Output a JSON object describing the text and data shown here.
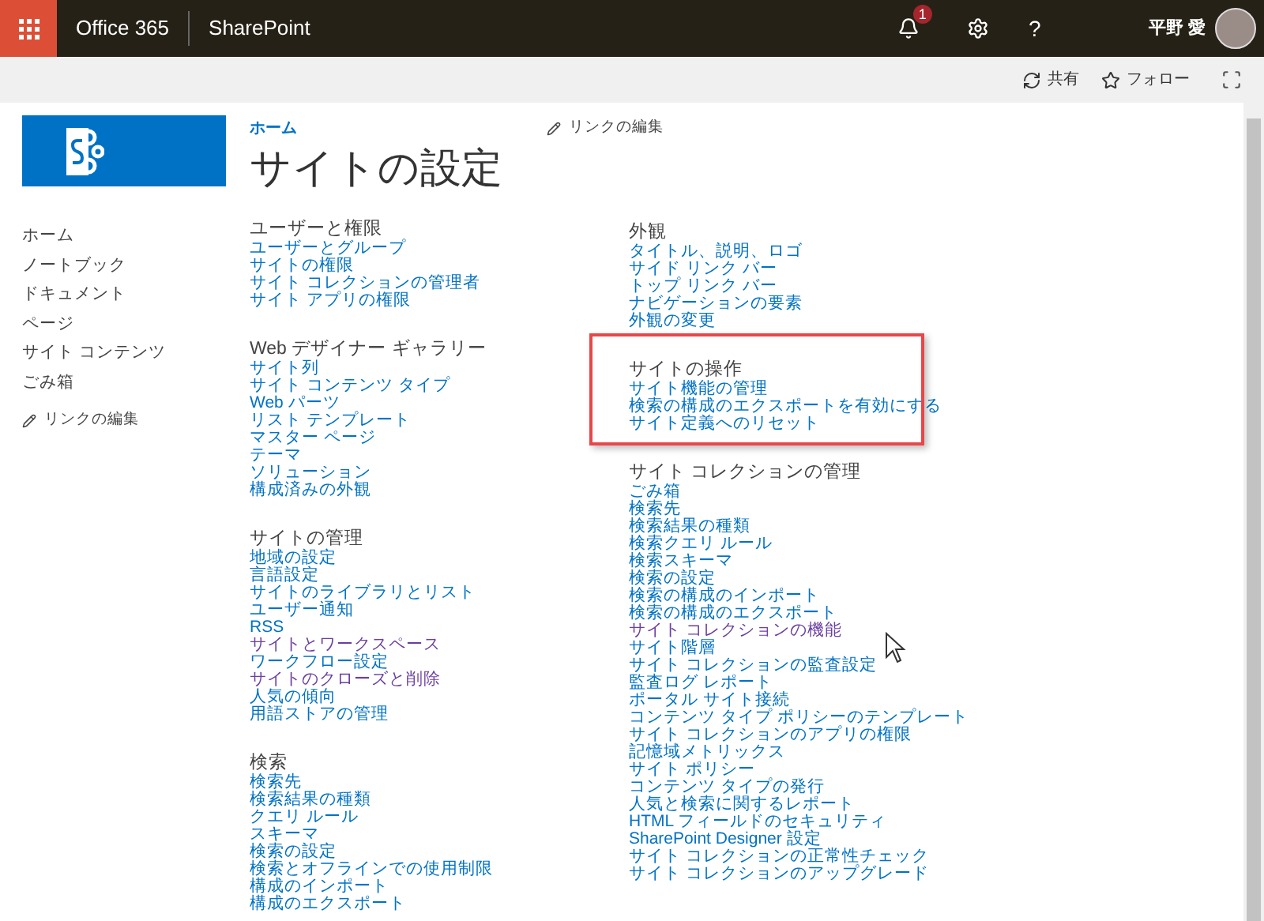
{
  "app_bar": {
    "brand": "Office 365",
    "app": "SharePoint",
    "notification_count": "1",
    "help": "?",
    "user_name": "平野 愛"
  },
  "toolbar": {
    "actions": [
      {
        "label": "共有",
        "kind": "share"
      },
      {
        "label": "フォロー",
        "kind": "follow"
      }
    ]
  },
  "breadcrumb": {
    "home": "ホーム",
    "edit_links": "リンクの編集"
  },
  "title": "サイトの設定",
  "quick_launch": {
    "items": [
      "ホーム",
      "ノートブック",
      "ドキュメント",
      "ページ",
      "サイト コンテンツ",
      "ごみ箱"
    ],
    "edit_links": "リンクの編集"
  },
  "columns": [
    {
      "sections": [
        {
          "heading": "ユーザーと権限",
          "highlighted": false,
          "links": [
            {
              "label": "ユーザーとグループ",
              "visited": false
            },
            {
              "label": "サイトの権限",
              "visited": false
            },
            {
              "label": "サイト コレクションの管理者",
              "visited": false
            },
            {
              "label": "サイト アプリの権限",
              "visited": false
            }
          ]
        },
        {
          "heading": "Web デザイナー ギャラリー",
          "highlighted": false,
          "links": [
            {
              "label": "サイト列",
              "visited": false
            },
            {
              "label": "サイト コンテンツ タイプ",
              "visited": false
            },
            {
              "label": "Web パーツ",
              "visited": false
            },
            {
              "label": "リスト テンプレート",
              "visited": false
            },
            {
              "label": "マスター ページ",
              "visited": false
            },
            {
              "label": "テーマ",
              "visited": false
            },
            {
              "label": "ソリューション",
              "visited": false
            },
            {
              "label": "構成済みの外観",
              "visited": false
            }
          ]
        },
        {
          "heading": "サイトの管理",
          "highlighted": false,
          "links": [
            {
              "label": "地域の設定",
              "visited": false
            },
            {
              "label": "言語設定",
              "visited": false
            },
            {
              "label": "サイトのライブラリとリスト",
              "visited": false
            },
            {
              "label": "ユーザー通知",
              "visited": false
            },
            {
              "label": "RSS",
              "visited": false
            },
            {
              "label": "サイトとワークスペース",
              "visited": true
            },
            {
              "label": "ワークフロー設定",
              "visited": false
            },
            {
              "label": "サイトのクローズと削除",
              "visited": true
            },
            {
              "label": "人気の傾向",
              "visited": false
            },
            {
              "label": "用語ストアの管理",
              "visited": false
            }
          ]
        },
        {
          "heading": "検索",
          "highlighted": false,
          "links": [
            {
              "label": "検索先",
              "visited": false
            },
            {
              "label": "検索結果の種類",
              "visited": false
            },
            {
              "label": "クエリ ルール",
              "visited": false
            },
            {
              "label": "スキーマ",
              "visited": false
            },
            {
              "label": "検索の設定",
              "visited": false
            },
            {
              "label": "検索とオフラインでの使用制限",
              "visited": false
            },
            {
              "label": "構成のインポート",
              "visited": false
            },
            {
              "label": "構成のエクスポート",
              "visited": false
            }
          ]
        }
      ]
    },
    {
      "sections": [
        {
          "heading": "外観",
          "highlighted": false,
          "links": [
            {
              "label": "タイトル、説明、ロゴ",
              "visited": false
            },
            {
              "label": "サイド リンク バー",
              "visited": false
            },
            {
              "label": "トップ リンク バー",
              "visited": false
            },
            {
              "label": "ナビゲーションの要素",
              "visited": false
            },
            {
              "label": "外観の変更",
              "visited": false
            }
          ]
        },
        {
          "heading": "サイトの操作",
          "highlighted": true,
          "links": [
            {
              "label": "サイト機能の管理",
              "visited": false
            },
            {
              "label": "検索の構成のエクスポートを有効にする",
              "visited": false
            },
            {
              "label": "サイト定義へのリセット",
              "visited": false
            }
          ]
        },
        {
          "heading": "サイト コレクションの管理",
          "highlighted": false,
          "links": [
            {
              "label": "ごみ箱",
              "visited": false
            },
            {
              "label": "検索先",
              "visited": false
            },
            {
              "label": "検索結果の種類",
              "visited": false
            },
            {
              "label": "検索クエリ ルール",
              "visited": false
            },
            {
              "label": "検索スキーマ",
              "visited": false
            },
            {
              "label": "検索の設定",
              "visited": false
            },
            {
              "label": "検索の構成のインポート",
              "visited": false
            },
            {
              "label": "検索の構成のエクスポート",
              "visited": false
            },
            {
              "label": "サイト コレクションの機能",
              "visited": true
            },
            {
              "label": "サイト階層",
              "visited": false
            },
            {
              "label": "サイト コレクションの監査設定",
              "visited": false
            },
            {
              "label": "監査ログ レポート",
              "visited": false
            },
            {
              "label": "ポータル サイト接続",
              "visited": false
            },
            {
              "label": "コンテンツ タイプ ポリシーのテンプレート",
              "visited": false
            },
            {
              "label": "サイト コレクションのアプリの権限",
              "visited": false
            },
            {
              "label": "記憶域メトリックス",
              "visited": false
            },
            {
              "label": "サイト ポリシー",
              "visited": false
            },
            {
              "label": "コンテンツ タイプの発行",
              "visited": false
            },
            {
              "label": "人気と検索に関するレポート",
              "visited": false
            },
            {
              "label": "HTML フィールドのセキュリティ",
              "visited": false
            },
            {
              "label": "SharePoint Designer 設定",
              "visited": false
            },
            {
              "label": "サイト コレクションの正常性チェック",
              "visited": false
            },
            {
              "label": "サイト コレクションのアップグレード",
              "visited": false
            }
          ]
        }
      ]
    }
  ]
}
